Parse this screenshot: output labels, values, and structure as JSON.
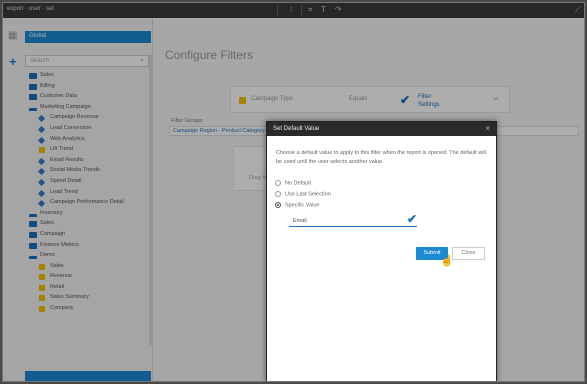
{
  "topbar": {
    "breadcrumb": "export · user · set",
    "icons": [
      "dots-icon",
      "grid-icon",
      "text-icon",
      "redo-icon"
    ]
  },
  "sidebar": {
    "header": "Global",
    "search_placeholder": "Search",
    "items": [
      {
        "label": "Sales",
        "type": "folder"
      },
      {
        "label": "Billing",
        "type": "folder"
      },
      {
        "label": "Customer Data",
        "type": "folder"
      },
      {
        "label": "Marketing Campaign",
        "type": "folder-open"
      },
      {
        "label": "Campaign Revenue",
        "type": "dot"
      },
      {
        "label": "Lead Conversion",
        "type": "dot"
      },
      {
        "label": "Web Analytics",
        "type": "dot"
      },
      {
        "label": "Lift Trend",
        "type": "ysq"
      },
      {
        "label": "Email Results",
        "type": "dot"
      },
      {
        "label": "Social Media Trends",
        "type": "dot"
      },
      {
        "label": "Spend Detail",
        "type": "dot"
      },
      {
        "label": "Lead Trend",
        "type": "dot"
      },
      {
        "label": "Campaign Performance Detail",
        "type": "dot"
      },
      {
        "label": "Inventory",
        "type": "folder-open"
      },
      {
        "label": "Sales",
        "type": "folder"
      },
      {
        "label": "Campaign",
        "type": "folder"
      },
      {
        "label": "Finance Metrics",
        "type": "folder"
      },
      {
        "label": "Demo",
        "type": "folder-open"
      },
      {
        "label": "Sales",
        "type": "ysq"
      },
      {
        "label": "Revenue",
        "type": "ysq"
      },
      {
        "label": "Retail",
        "type": "ysq"
      },
      {
        "label": "Sales Summary",
        "type": "ysq"
      },
      {
        "label": "Company",
        "type": "ysq"
      }
    ]
  },
  "main": {
    "title": "Configure Filters",
    "filter": {
      "name": "Campaign Type",
      "operator": "Equals",
      "side_label_1": "Filter",
      "side_label_2": "Settings"
    },
    "section_label": "Filter Groups",
    "section_bar": "Campaign Region · Product Category · Campaign Status",
    "section_box_text": "Drag filters here to group"
  },
  "modal": {
    "title": "Set Default Value",
    "description": "Choose a default value to apply to this filter when the report is opened. The default will be used until the user selects another value.",
    "options": [
      {
        "label": "No Default",
        "selected": false
      },
      {
        "label": "Use Last Selection",
        "selected": false
      },
      {
        "label": "Specific Value",
        "selected": true
      }
    ],
    "selected_value": "Email",
    "ok_label": "Submit",
    "cancel_label": "Close"
  },
  "colors": {
    "accent": "#1b8ad3",
    "folder": "#1b6fbd",
    "highlight": "#f2c100",
    "toolbar": "#3c3c3c"
  }
}
